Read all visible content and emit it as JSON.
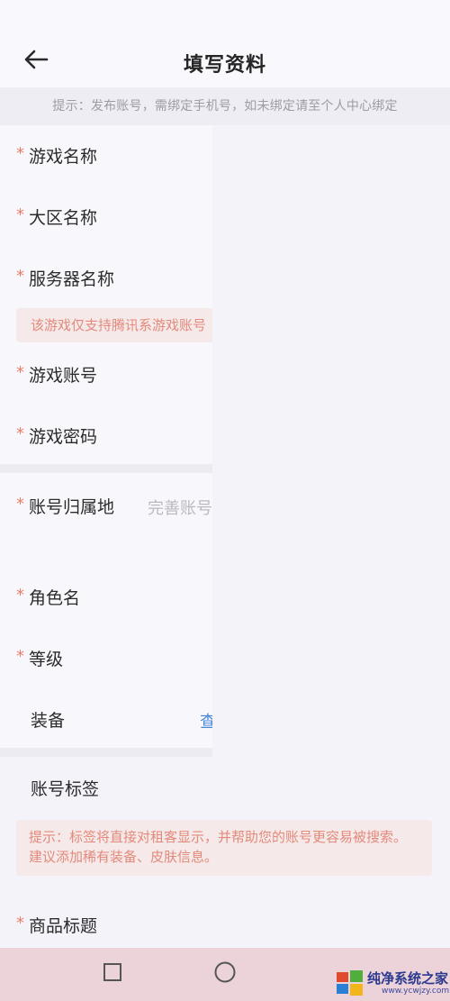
{
  "header": {
    "title": "填写资料"
  },
  "hint": "提示：发布账号，需绑定手机号，如未绑定请至个人中心绑定",
  "required_mark": "*",
  "fields": {
    "game_name": "游戏名称",
    "region_name": "大区名称",
    "server_name": "服务器名称",
    "server_notice": "该游戏仅支持腾讯系游戏账号",
    "game_account": "游戏账号",
    "game_password": "游戏密码",
    "account_location": "账号归属地",
    "account_location_value": "完善账号",
    "role_name": "角色名",
    "level": "等级",
    "equipment": "装备",
    "equipment_link": "查",
    "account_tags": "账号标签",
    "tags_notice": "提示：标签将直接对租客显示，并帮助您的账号更容易被搜索。建议添加稀有装备、皮肤信息。",
    "product_title": "商品标题"
  },
  "watermark": {
    "text": "纯净系统之家",
    "sub": "www.ycwjzy.com"
  },
  "colors": {
    "required": "#e5806d",
    "link": "#4a86d8",
    "notice_bg": "#f6e9ea",
    "notice_text": "#e28a7a",
    "navbar": "#ecd3d9"
  }
}
